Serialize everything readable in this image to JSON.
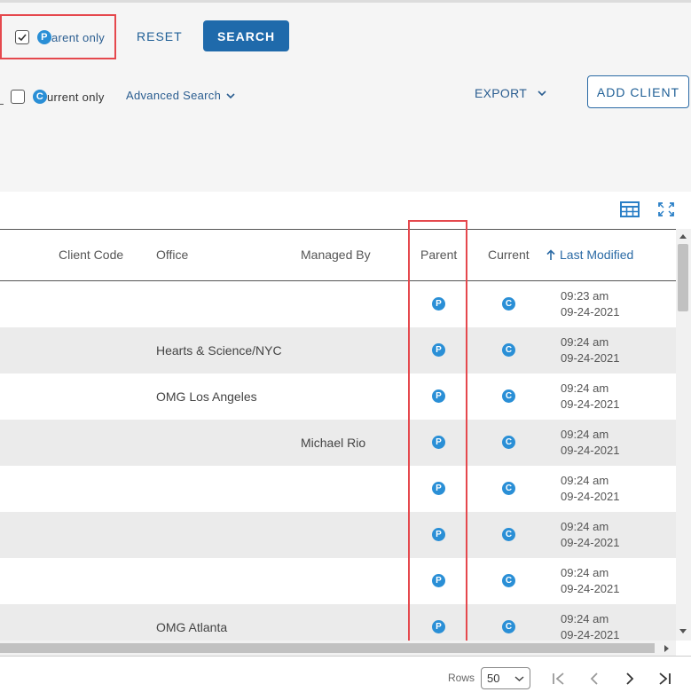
{
  "filters": {
    "parent_only": {
      "label": "arent only",
      "badge": "P",
      "checked": true
    },
    "reset_label": "RESET",
    "search_label": "SEARCH",
    "current_only": {
      "label": "urrent only",
      "badge": "C",
      "checked": false
    },
    "advanced_search_label": "Advanced Search",
    "export_label": "EXPORT",
    "add_client_label": "ADD CLIENT"
  },
  "table": {
    "columns": [
      "Client Code",
      "Office",
      "Managed By",
      "Parent",
      "Current",
      "Last Modified"
    ],
    "sort_column": "Last Modified",
    "rows": [
      {
        "client_code": "",
        "office": "",
        "managed_by": "",
        "parent": "P",
        "current": "C",
        "time": "09:23 am",
        "date": "09-24-2021"
      },
      {
        "client_code": "",
        "office": "Hearts & Science/NYC",
        "managed_by": "",
        "parent": "P",
        "current": "C",
        "time": "09:24 am",
        "date": "09-24-2021"
      },
      {
        "client_code": "",
        "office": "OMG Los Angeles",
        "managed_by": "",
        "parent": "P",
        "current": "C",
        "time": "09:24 am",
        "date": "09-24-2021"
      },
      {
        "client_code": "",
        "office": "",
        "managed_by": "Michael Rio",
        "parent": "P",
        "current": "C",
        "time": "09:24 am",
        "date": "09-24-2021"
      },
      {
        "client_code": "",
        "office": "",
        "managed_by": "",
        "parent": "P",
        "current": "C",
        "time": "09:24 am",
        "date": "09-24-2021"
      },
      {
        "client_code": "",
        "office": "",
        "managed_by": "",
        "parent": "P",
        "current": "C",
        "time": "09:24 am",
        "date": "09-24-2021"
      },
      {
        "client_code": "",
        "office": "",
        "managed_by": "",
        "parent": "P",
        "current": "C",
        "time": "09:24 am",
        "date": "09-24-2021"
      },
      {
        "client_code": "",
        "office": "OMG Atlanta",
        "managed_by": "",
        "parent": "P",
        "current": "C",
        "time": "09:24 am",
        "date": "09-24-2021"
      }
    ]
  },
  "footer": {
    "rows_label": "Rows",
    "rows_value": "50",
    "icons": [
      "first-page-icon",
      "prev-page-icon",
      "next-page-icon",
      "last-page-icon"
    ]
  },
  "colors": {
    "accent": "#1f6aab",
    "badge": "#2a8fd6",
    "highlight": "#e5484d"
  }
}
